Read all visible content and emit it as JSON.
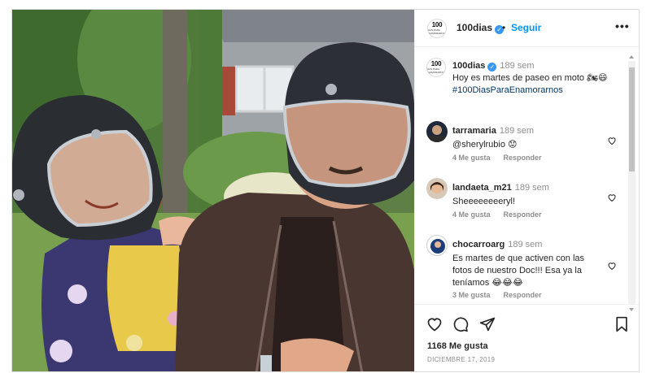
{
  "post": {
    "username": "100dias",
    "verified": true,
    "follow_label": "Seguir",
    "separator": "•",
    "more_label": "•••",
    "avatar_logo": {
      "big": "100",
      "small": "DIAS PARA ENAMORARNOS"
    },
    "photo_alt": "Pareja con cascos de moto sonriendo"
  },
  "caption": {
    "username": "100dias",
    "time": "189 sem",
    "text": "Hoy es martes de paseo en moto 🏍😄",
    "hashtag": "#100DiasParaEnamorarnos"
  },
  "comments": [
    {
      "username": "tarramaria",
      "time": "189 sem",
      "text": "@sherylrubio 😟",
      "likes": "4 Me gusta",
      "reply": "Responder"
    },
    {
      "username": "landaeta_m21",
      "time": "189 sem",
      "text": "Sheeeeeeeeryl!",
      "likes": "4 Me gusta",
      "reply": "Responder"
    },
    {
      "username": "chocarroarg",
      "time": "189 sem",
      "text_line1": "Es martes de que activen con las",
      "text_line2": "fotos de nuestro Doc!!! Esa ya la",
      "text_line3": "teníamos 😂😂😂",
      "likes": "3 Me gusta",
      "reply": "Responder"
    }
  ],
  "actions": {
    "like_icon": "heart-icon",
    "comment_icon": "comment-icon",
    "share_icon": "share-icon",
    "save_icon": "bookmark-icon"
  },
  "likes_count": "1168 Me gusta",
  "date": "DICIEMBRE 17, 2019",
  "colors": {
    "link": "#0095f6",
    "verified": "#3897f0",
    "muted": "#8e8e8e",
    "text": "#262626"
  }
}
